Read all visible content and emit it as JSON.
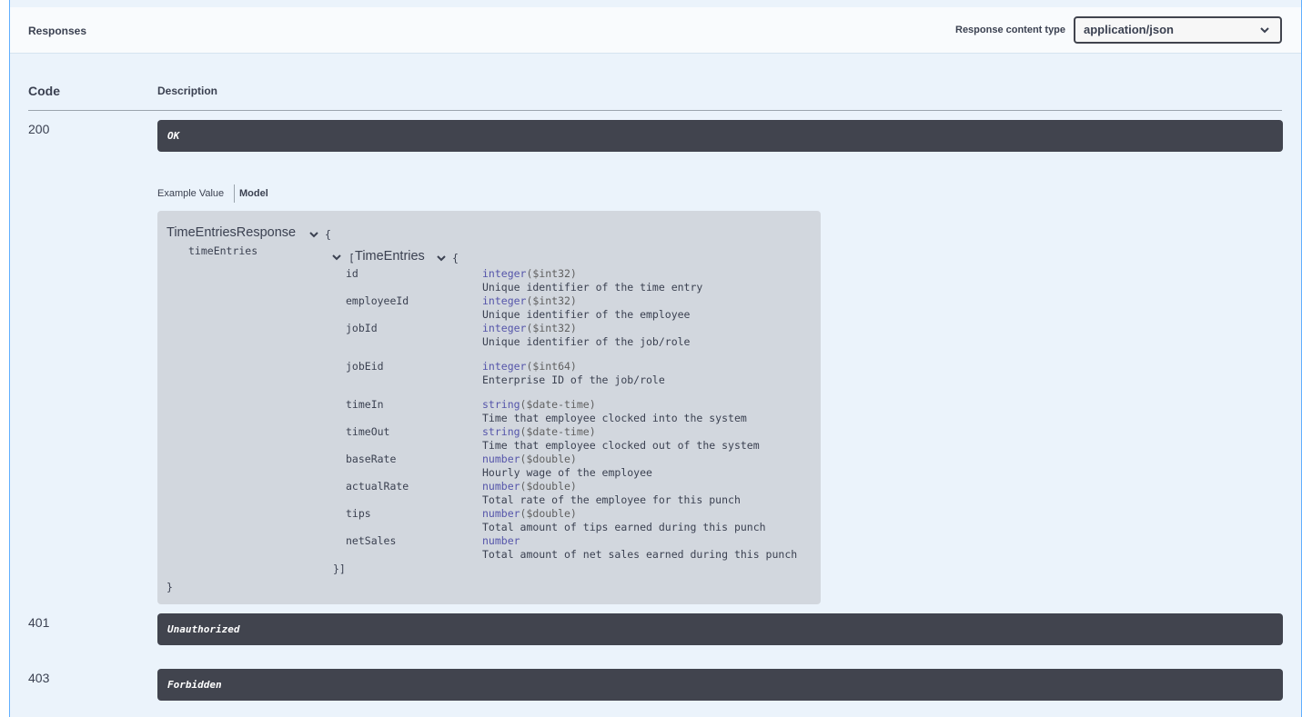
{
  "responses": {
    "title": "Responses",
    "content_type_label": "Response content type",
    "content_type_value": "application/json"
  },
  "table": {
    "code_header": "Code",
    "description_header": "Description"
  },
  "rows": [
    {
      "code": "200",
      "description": "OK"
    },
    {
      "code": "401",
      "description": "Unauthorized"
    },
    {
      "code": "403",
      "description": "Forbidden"
    }
  ],
  "tabs": {
    "example": "Example Value",
    "model": "Model",
    "active": "Model"
  },
  "model": {
    "name": "TimeEntriesResponse",
    "open_brace": "{",
    "close_brace": "}",
    "field": "timeEntries",
    "array_open": "[",
    "inner_name": "TimeEntries",
    "inner_open": "{",
    "inner_close": "}]",
    "properties": [
      {
        "name": "id",
        "type": "integer",
        "format": "($int32)",
        "description": "Unique identifier of the time entry"
      },
      {
        "name": "employeeId",
        "type": "integer",
        "format": "($int32)",
        "description": "Unique identifier of the employee"
      },
      {
        "name": "jobId",
        "type": "integer",
        "format": "($int32)",
        "description": "Unique identifier of the job/role"
      },
      {
        "name": "jobEid",
        "type": "integer",
        "format": "($int64)",
        "description": "Enterprise ID of the job/role"
      },
      {
        "name": "timeIn",
        "type": "string",
        "format": "($date-time)",
        "description": "Time that employee clocked into the system"
      },
      {
        "name": "timeOut",
        "type": "string",
        "format": "($date-time)",
        "description": "Time that employee clocked out of the system"
      },
      {
        "name": "baseRate",
        "type": "number",
        "format": "($double)",
        "description": "Hourly wage of the employee"
      },
      {
        "name": "actualRate",
        "type": "number",
        "format": "($double)",
        "description": "Total rate of the employee for this punch"
      },
      {
        "name": "tips",
        "type": "number",
        "format": "($double)",
        "description": "Total amount of tips earned during this punch"
      },
      {
        "name": "netSales",
        "type": "number",
        "format": "",
        "description": "Total amount of net sales earned during this punch"
      }
    ]
  },
  "colors": {
    "panel_bg": "#ebf3fb",
    "panel_border": "#61affe",
    "bar_bg": "#41444e",
    "model_bg": "#d2d7de",
    "type_color": "#55a"
  },
  "icons": {
    "select": "chevron-down-icon",
    "model_toggle": "chevron-down-icon",
    "inner_toggle": "chevron-down-icon",
    "array_toggle": "chevron-down-icon"
  }
}
